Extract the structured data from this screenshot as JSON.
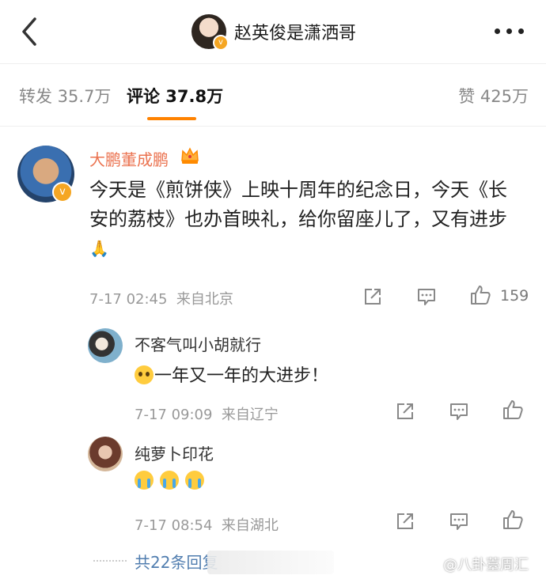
{
  "header": {
    "title": "赵英俊是潇洒哥",
    "back_icon": "chevron-left-icon",
    "more_icon": "more-horizontal-icon",
    "verified_badge_color": "#f5a623"
  },
  "tabs": {
    "repost": "转发 35.7万",
    "comment": "评论 37.8万",
    "like": "赞 425万",
    "active_color": "#ff8200"
  },
  "comment": {
    "author": "大鹏董成鹏",
    "author_color": "#eb7350",
    "text": "今天是《煎饼侠》上映十周年的纪念日，今天《长安的荔枝》也办首映礼，给你留座儿了，又有进步",
    "time": "7-17 02:45",
    "location": "来自北京",
    "like_count": "159",
    "icons": [
      "share-icon",
      "comment-icon",
      "like-icon",
      "crown-icon",
      "folded-hands-emoji"
    ]
  },
  "replies": [
    {
      "author": "不客气叫小胡就行",
      "text": "一年又一年的大进步！",
      "time": "7-17 09:09",
      "location": "来自辽宁"
    },
    {
      "author": "纯萝卜印花",
      "text": "",
      "time": "7-17 08:54",
      "location": "来自湖北"
    }
  ],
  "more_replies": "共22条回复",
  "watermark": "@八卦薹周汇",
  "link_color": "#507daf"
}
